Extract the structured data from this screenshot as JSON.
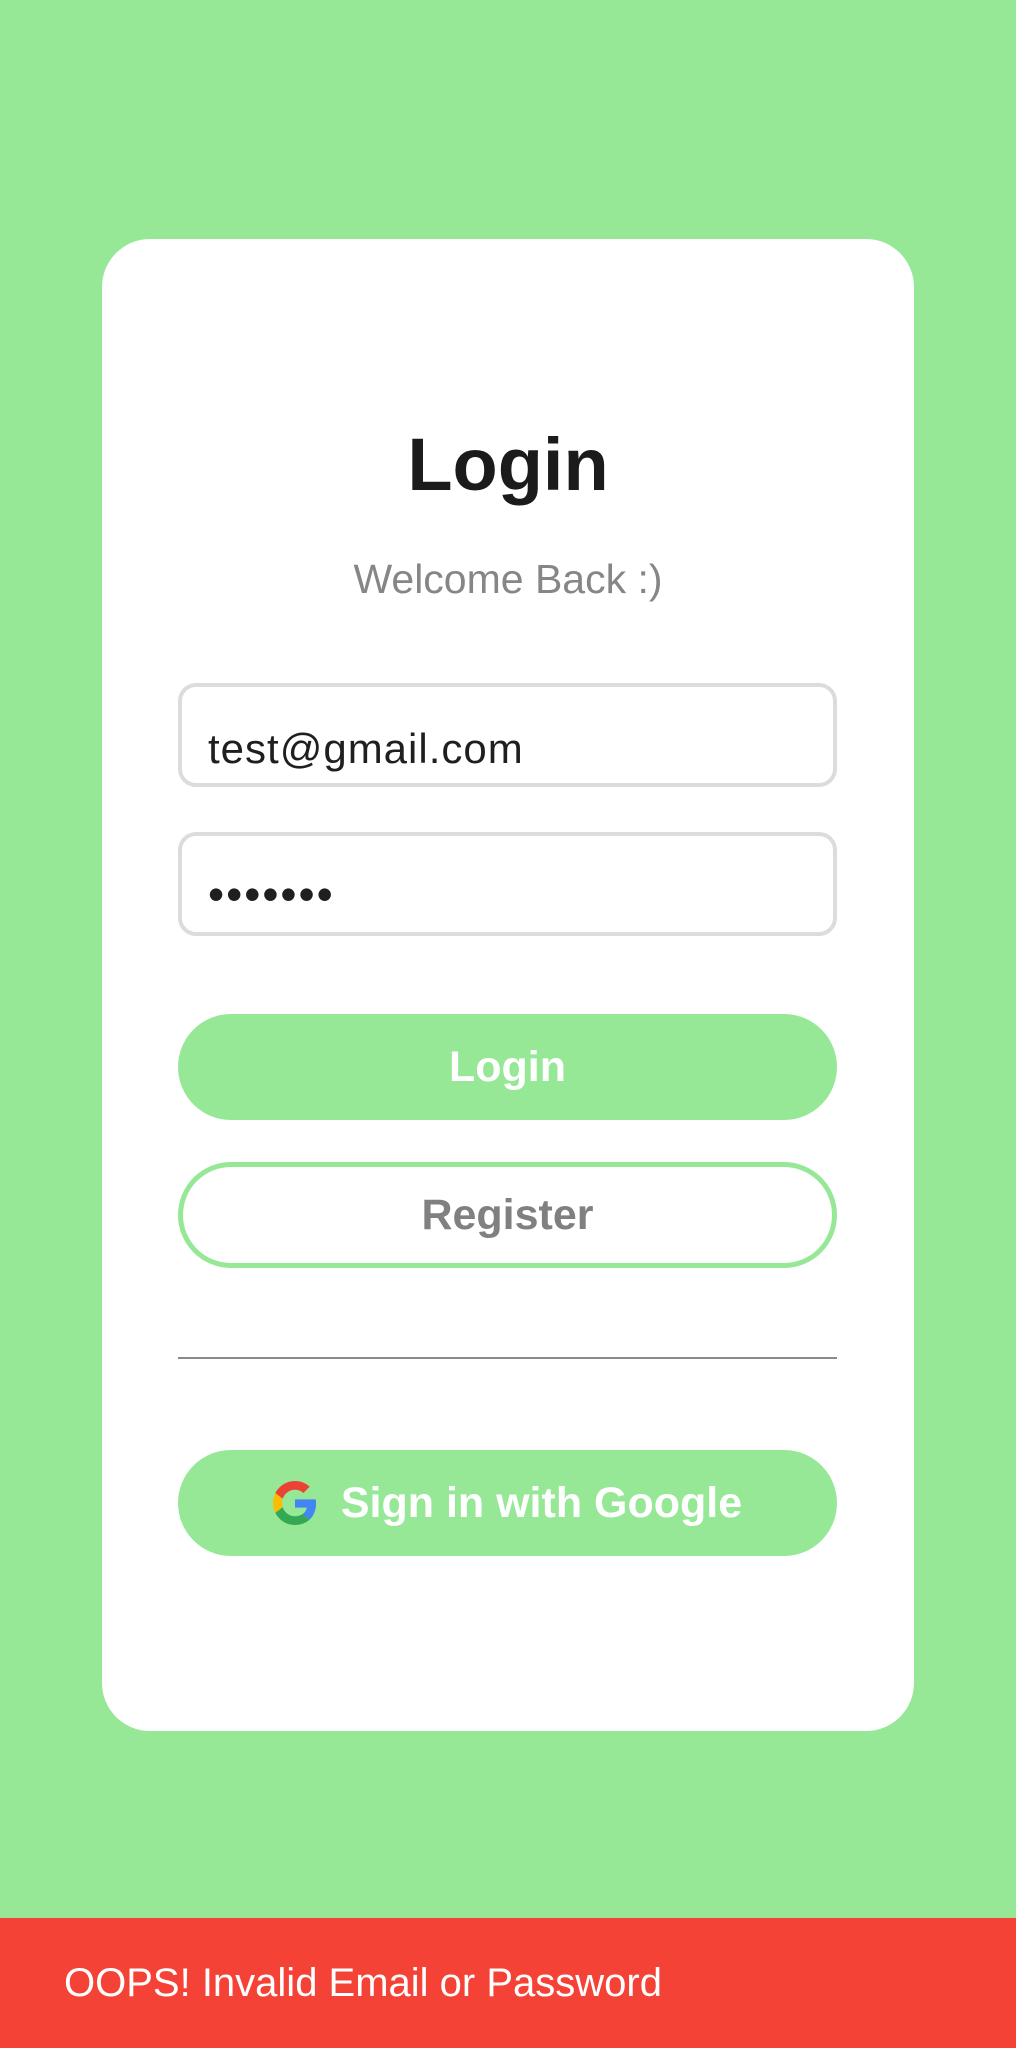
{
  "login_card": {
    "title": "Login",
    "subtitle": "Welcome Back :)",
    "email_value": "test@gmail.com",
    "password_value": "•••••••",
    "login_button_label": "Login",
    "register_button_label": "Register",
    "google_button_label": "Sign in with Google",
    "google_icon": "google-g-icon"
  },
  "snackbar": {
    "message": "OOPS! Invalid Email or Password"
  },
  "colors": {
    "background": "#96E897",
    "card": "#FFFFFF",
    "accent": "#96E897",
    "error": "#F44336",
    "field_border": "#DCDCDC",
    "subtitle": "#868686"
  }
}
